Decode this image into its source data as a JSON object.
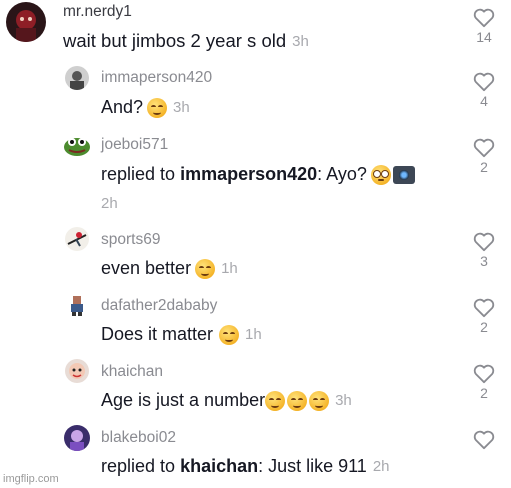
{
  "comments": [
    {
      "username": "mr.nerdy1",
      "text": "wait but jimbos 2 year s old",
      "time": "3h",
      "likes": "14",
      "avatar": "dark-red-avatar"
    },
    {
      "username": "immaperson420",
      "text": "And?",
      "time": "3h",
      "likes": "4",
      "avatar": "gray-avatar"
    },
    {
      "username": "joeboi571",
      "reply_prefix": "replied to",
      "mention": "immaperson420",
      "text": ": Ayo?",
      "time": "2h",
      "likes": "2",
      "avatar": "pepe-avatar"
    },
    {
      "username": "sports69",
      "text": "even better",
      "time": "1h",
      "likes": "3",
      "avatar": "skater-avatar"
    },
    {
      "username": "dafather2dababy",
      "text": "Does it matter",
      "time": "1h",
      "likes": "2",
      "avatar": "pixel-avatar"
    },
    {
      "username": "khaichan",
      "text": "Age is just a number",
      "time": "3h",
      "likes": "2",
      "avatar": "face-avatar"
    },
    {
      "username": "blakeboi02",
      "reply_prefix": "replied to",
      "mention": "khaichan",
      "text": ": Just like 911",
      "time": "2h",
      "likes": "",
      "avatar": "purple-avatar"
    }
  ],
  "watermark": "imgflip.com",
  "colors": {
    "text": "#161823",
    "username": "#8a8b91",
    "time": "#a8a9ae"
  }
}
